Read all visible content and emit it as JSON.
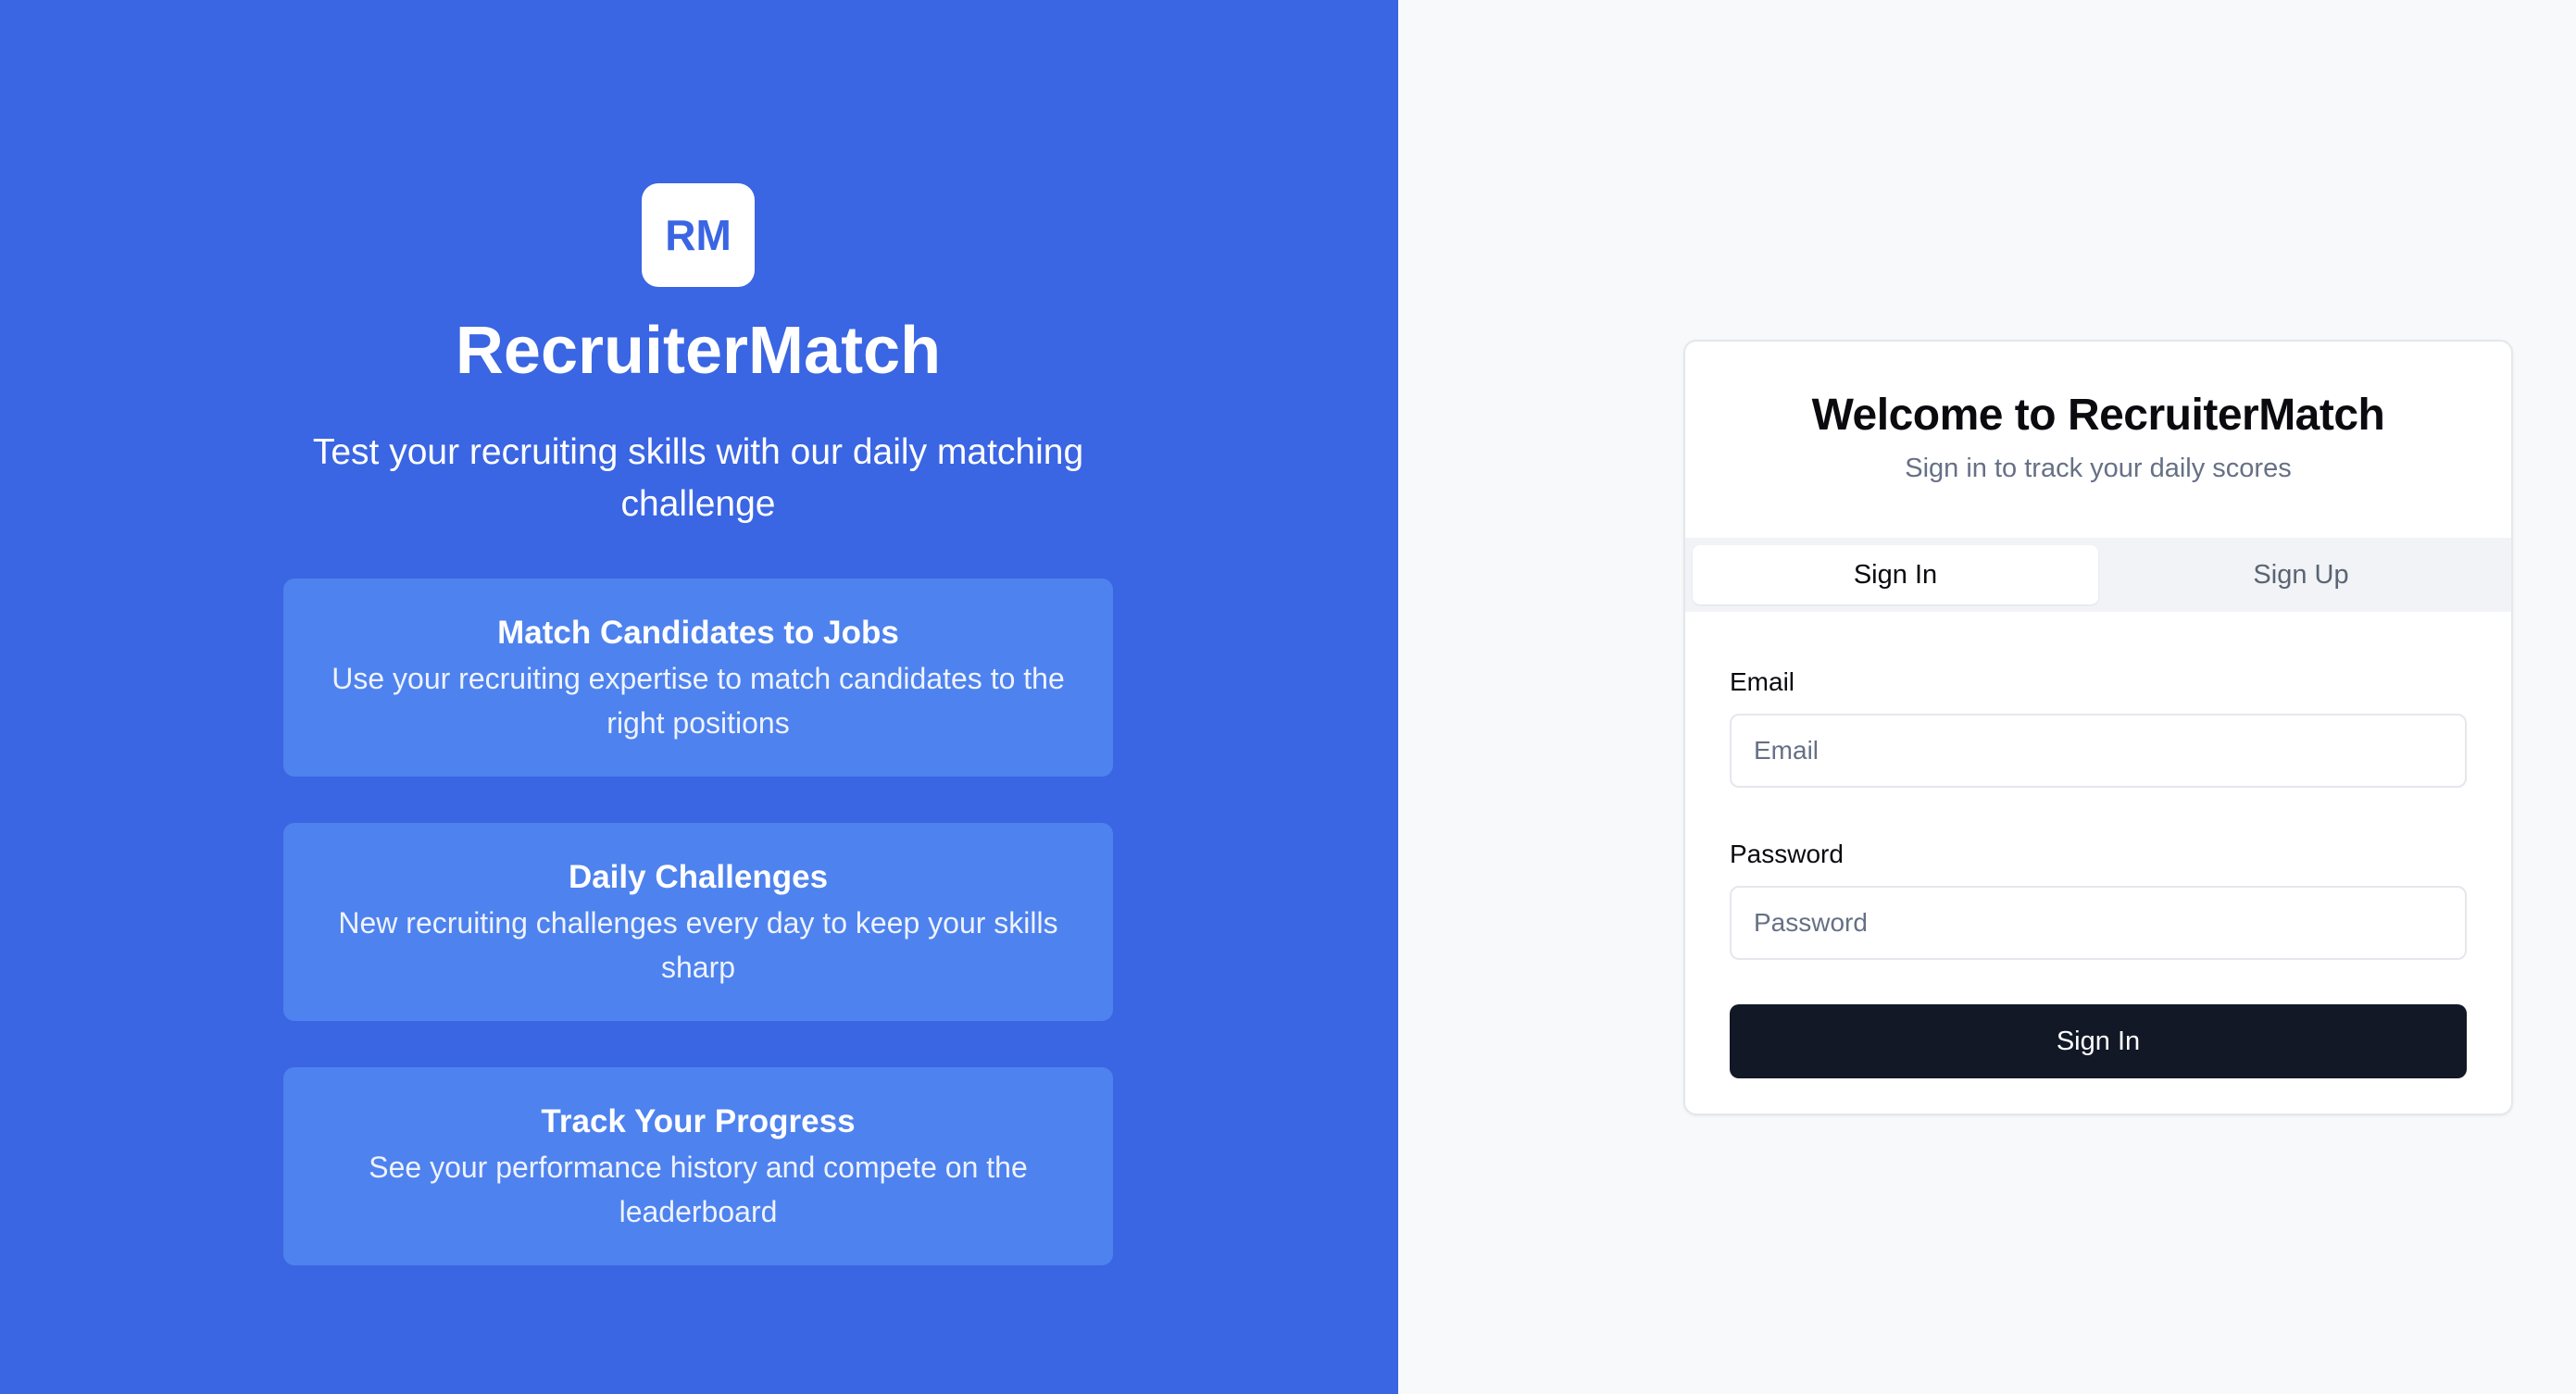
{
  "brand": {
    "logo_text": "RM",
    "name": "RecruiterMatch",
    "tagline": "Test your recruiting skills with our daily matching challenge"
  },
  "features": [
    {
      "title": "Match Candidates to Jobs",
      "description": "Use your recruiting expertise to match candidates to the right positions"
    },
    {
      "title": "Daily Challenges",
      "description": "New recruiting challenges every day to keep your skills sharp"
    },
    {
      "title": "Track Your Progress",
      "description": "See your performance history and compete on the leaderboard"
    }
  ],
  "auth": {
    "title": "Welcome to RecruiterMatch",
    "subtitle": "Sign in to track your daily scores",
    "tabs": [
      {
        "label": "Sign In",
        "active": true
      },
      {
        "label": "Sign Up",
        "active": false
      }
    ],
    "email": {
      "label": "Email",
      "placeholder": "Email",
      "value": ""
    },
    "password": {
      "label": "Password",
      "placeholder": "Password",
      "value": ""
    },
    "submit_label": "Sign In"
  },
  "colors": {
    "hero_background": "#3a65e3",
    "feature_card": "#4e82ee",
    "auth_background": "#f8f9fb",
    "primary_button": "#121826"
  }
}
